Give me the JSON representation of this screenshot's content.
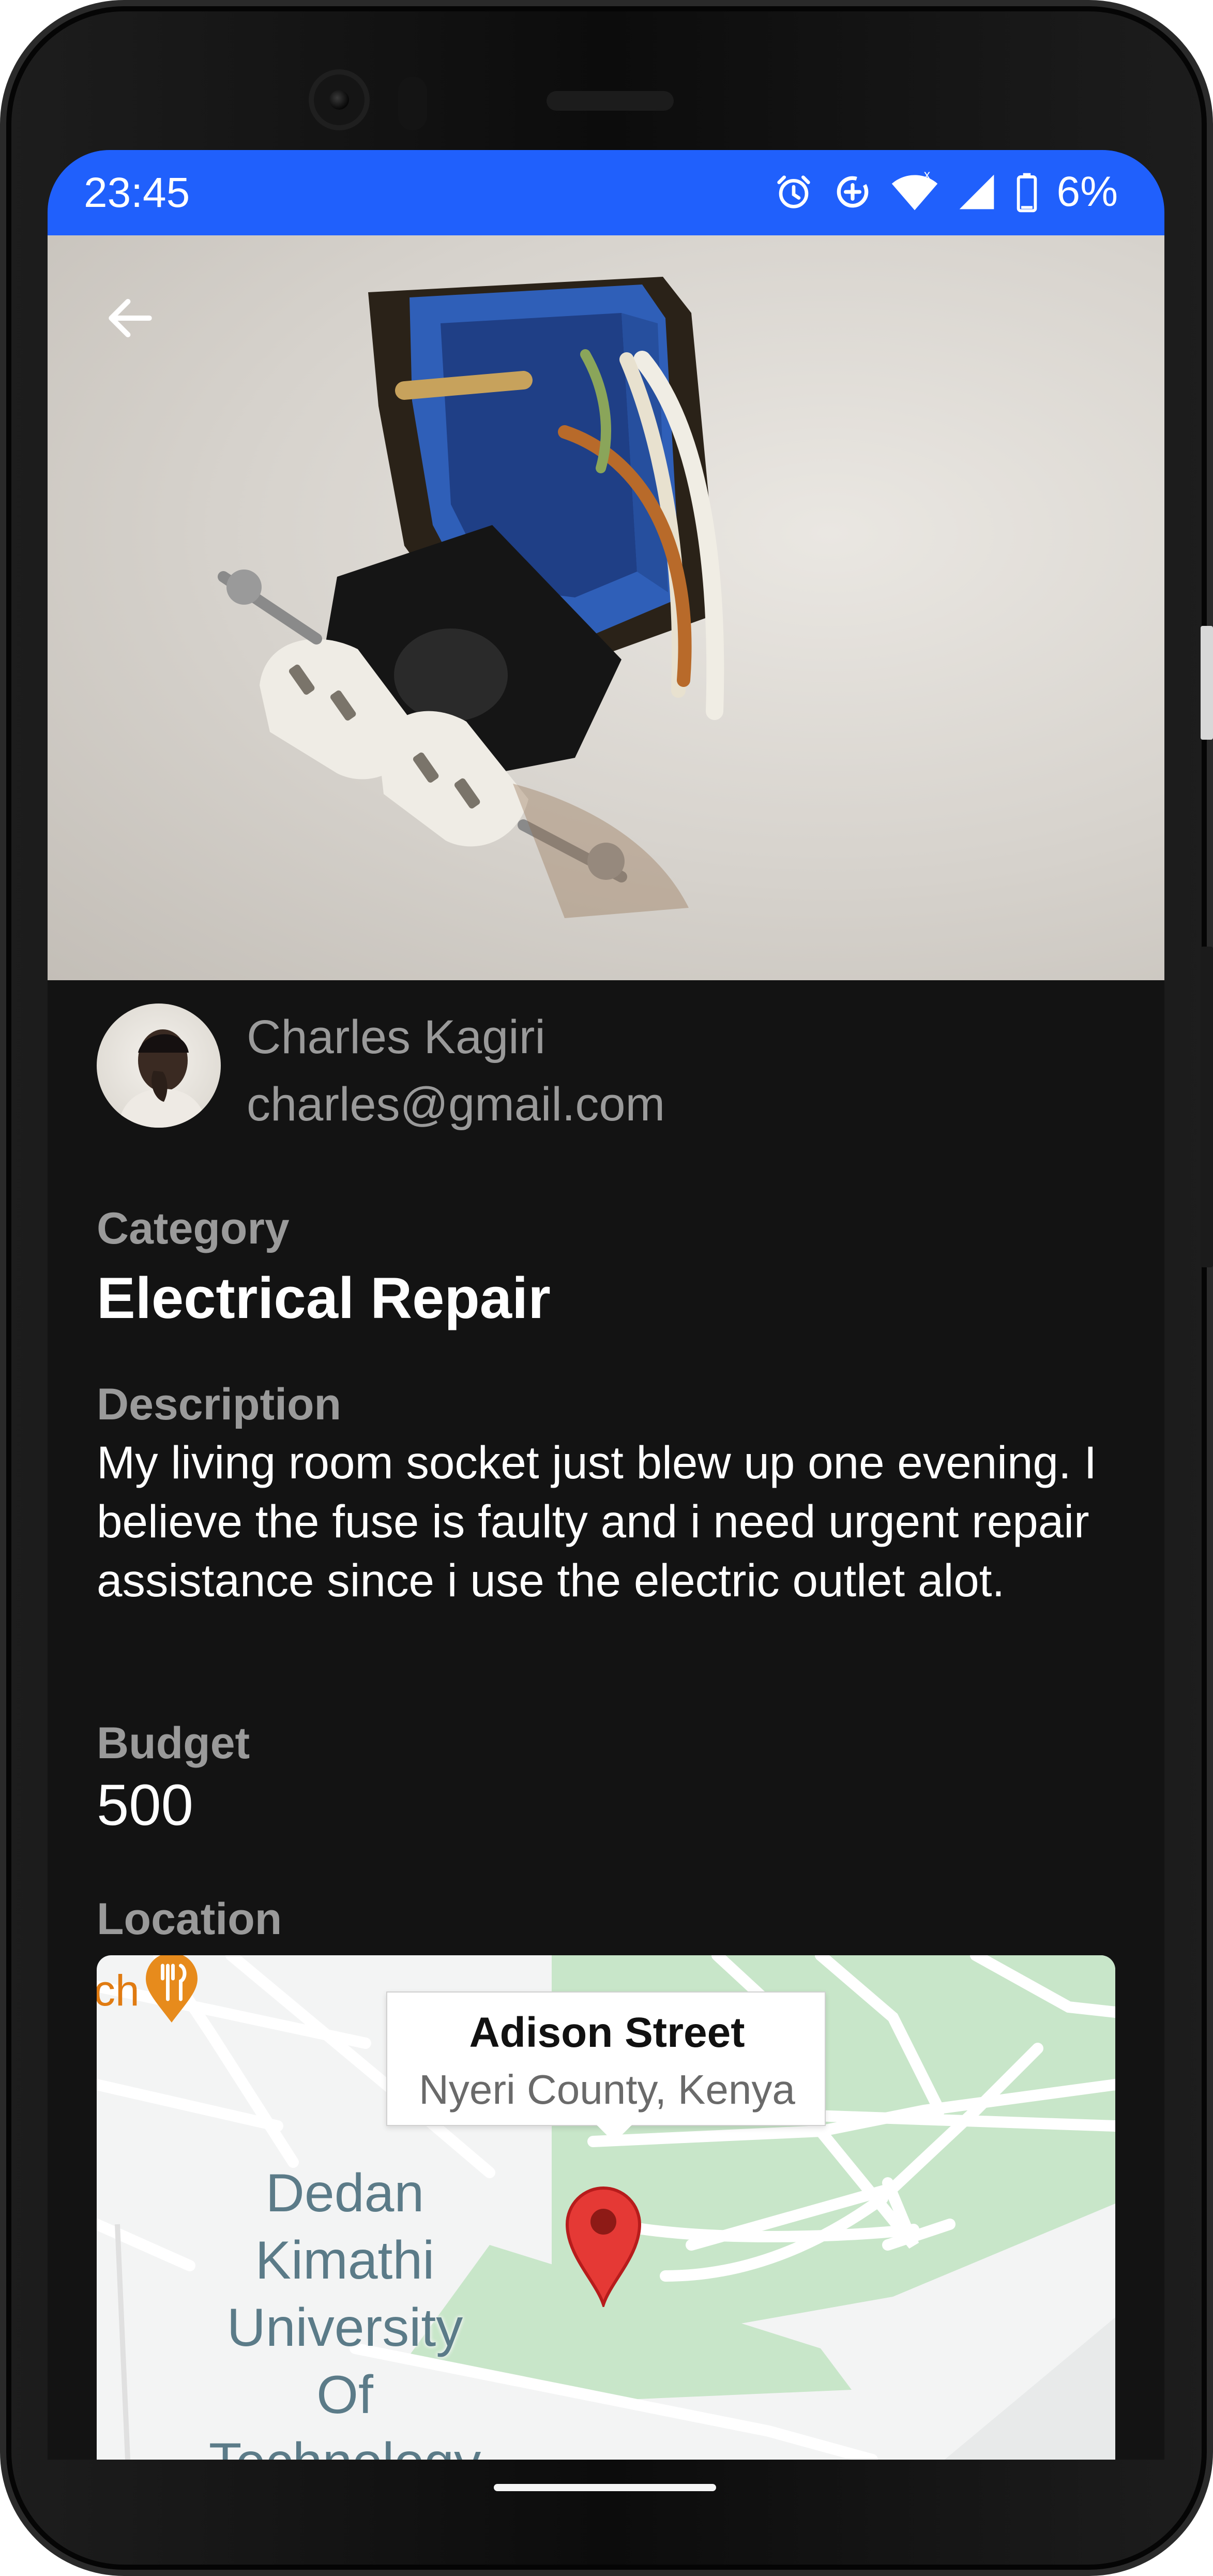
{
  "status_bar": {
    "time": "23:45",
    "battery_percent": "6%",
    "icons": [
      "alarm-icon",
      "data-saver-icon",
      "wifi-icon",
      "cellular-signal-icon",
      "battery-icon"
    ],
    "background_color": "#2060fc"
  },
  "hero": {
    "image": "damaged-wall-socket-photo",
    "back_icon": "arrow-left-icon"
  },
  "poster": {
    "name": "Charles Kagiri",
    "email": "charles@gmail.com"
  },
  "details": {
    "category_label": "Category",
    "category_value": "Electrical Repair",
    "description_label": "Description",
    "description_value": "My living room socket just blew up one evening. I believe the fuse is faulty and i need urgent repair assistance since i use the electric outlet alot.",
    "budget_label": "Budget",
    "budget_value": "500",
    "location_label": "Location"
  },
  "map": {
    "edge_text": "ch",
    "place_label": "Dedan Kimathi University Of Technology",
    "info_title": "Adison Street",
    "info_subtitle": "Nyeri County, Kenya",
    "pin_color": "#e53935",
    "park_color": "#c8e6c9",
    "poi_color": "#e07b12"
  }
}
